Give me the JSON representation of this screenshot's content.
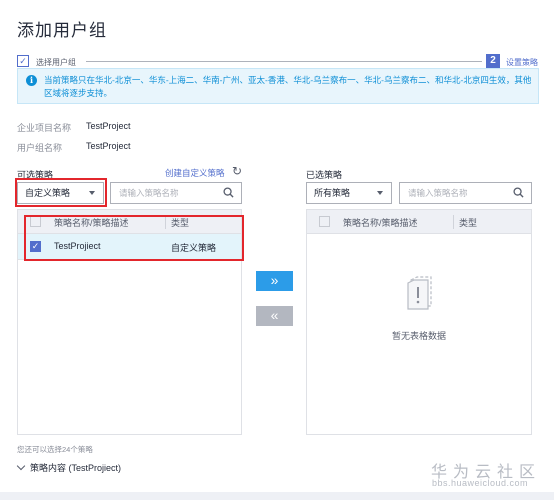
{
  "dialog": {
    "title": "添加用户组",
    "close": "×"
  },
  "steps": {
    "step1": {
      "label": "选择用户组",
      "mark": "✓"
    },
    "step2": {
      "number": "2",
      "label": "设置策略"
    }
  },
  "notice": {
    "text": "当前策略只在华北-北京一、华东-上海二、华南-广州、亚太-香港、华北-乌兰察布一、华北-乌兰察布二、和华北-北京四生效，其他区域将逐步支持。"
  },
  "info": {
    "project_label": "企业项目名称",
    "project_value": "TestProject",
    "group_label": "用户组名称",
    "group_value": "TestProject"
  },
  "available": {
    "title": "可选策略",
    "create_link": "创建自定义策略",
    "filter_value": "自定义策略",
    "search_placeholder": "请输入策略名称",
    "col_name": "策略名称/策略描述",
    "col_type": "类型",
    "rows": [
      {
        "name": "TestProjiect",
        "type": "自定义策略",
        "checked": true
      }
    ]
  },
  "selected": {
    "title": "已选策略",
    "filter_value": "所有策略",
    "search_placeholder": "请输入策略名称",
    "col_name": "策略名称/策略描述",
    "col_type": "类型",
    "empty_text": "暂无表格数据"
  },
  "buttons": {
    "add": "»",
    "remove": "«"
  },
  "hint": "您还可以选择24个策略",
  "policy_content": "策略内容 (TestProjiect)",
  "watermark": {
    "cn": "华为云社区",
    "url": "bbs.huaweicloud.com"
  },
  "colors": {
    "accent": "#526ecc",
    "add_button": "#2c9ce8",
    "remove_button": "#b3b7c0",
    "highlight": "#e3262c",
    "selected_row": "#e3f4fb"
  }
}
